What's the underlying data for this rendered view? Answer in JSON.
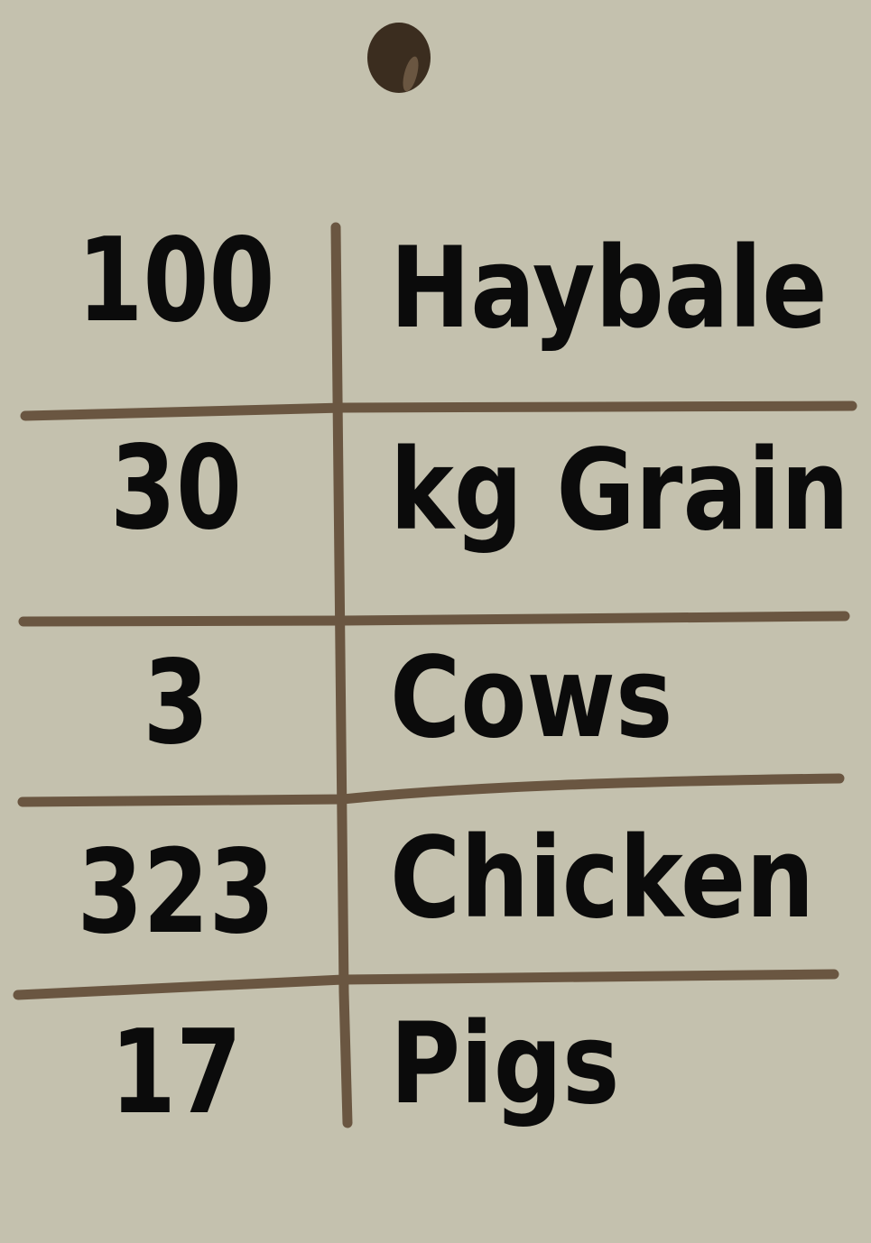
{
  "note": {
    "paper_color": "#c4c1ae",
    "line_color": "#6a5641",
    "ink_color": "#0b0b0b",
    "pin_icon": "pushpin-icon",
    "rows": [
      {
        "quantity": "100",
        "item": "Haybale"
      },
      {
        "quantity": "30",
        "item": "kg Grain"
      },
      {
        "quantity": "3",
        "item": "Cows"
      },
      {
        "quantity": "323",
        "item": "Chicken"
      },
      {
        "quantity": "17",
        "item": "Pigs"
      }
    ]
  }
}
